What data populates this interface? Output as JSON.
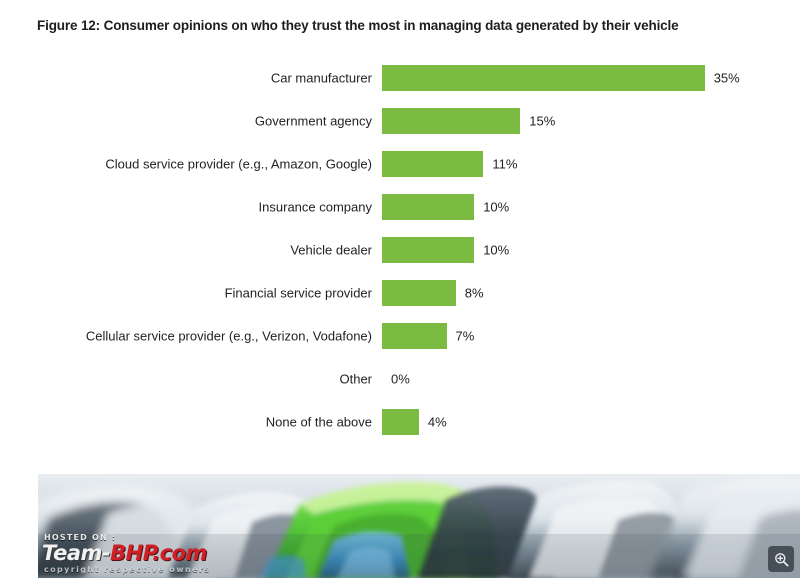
{
  "figure": {
    "title": "Figure 12: Consumer opinions on who they trust the most in managing data generated by their vehicle"
  },
  "chart_data": {
    "type": "bar",
    "orientation": "horizontal",
    "title": "Figure 12: Consumer opinions on who they trust the most in managing data generated by their vehicle",
    "xlabel": "",
    "ylabel": "",
    "xlim": [
      0,
      35
    ],
    "grid": false,
    "legend": null,
    "bar_color": "#7cbb42",
    "value_suffix": "%",
    "categories": [
      "Car manufacturer",
      "Government agency",
      "Cloud service provider (e.g., Amazon, Google)",
      "Insurance company",
      "Vehicle dealer",
      "Financial service provider",
      "Cellular service provider (e.g., Verizon, Vodafone)",
      "Other",
      "None of the above"
    ],
    "values": [
      35,
      15,
      11,
      10,
      10,
      8,
      7,
      0,
      4
    ],
    "value_labels": [
      "35%",
      "15%",
      "11%",
      "10%",
      "10%",
      "8%",
      "7%",
      "0%",
      "4%"
    ]
  },
  "photo": {
    "alt": "Row of parked cars, one bright green, rest white and silver",
    "watermark": {
      "hosted_on": "HOSTED ON :",
      "site_team": "Team-",
      "site_bhp": "BHP.com",
      "copyright": "copyright respective owners"
    }
  },
  "controls": {
    "zoom_icon": "magnifier-plus-icon"
  }
}
